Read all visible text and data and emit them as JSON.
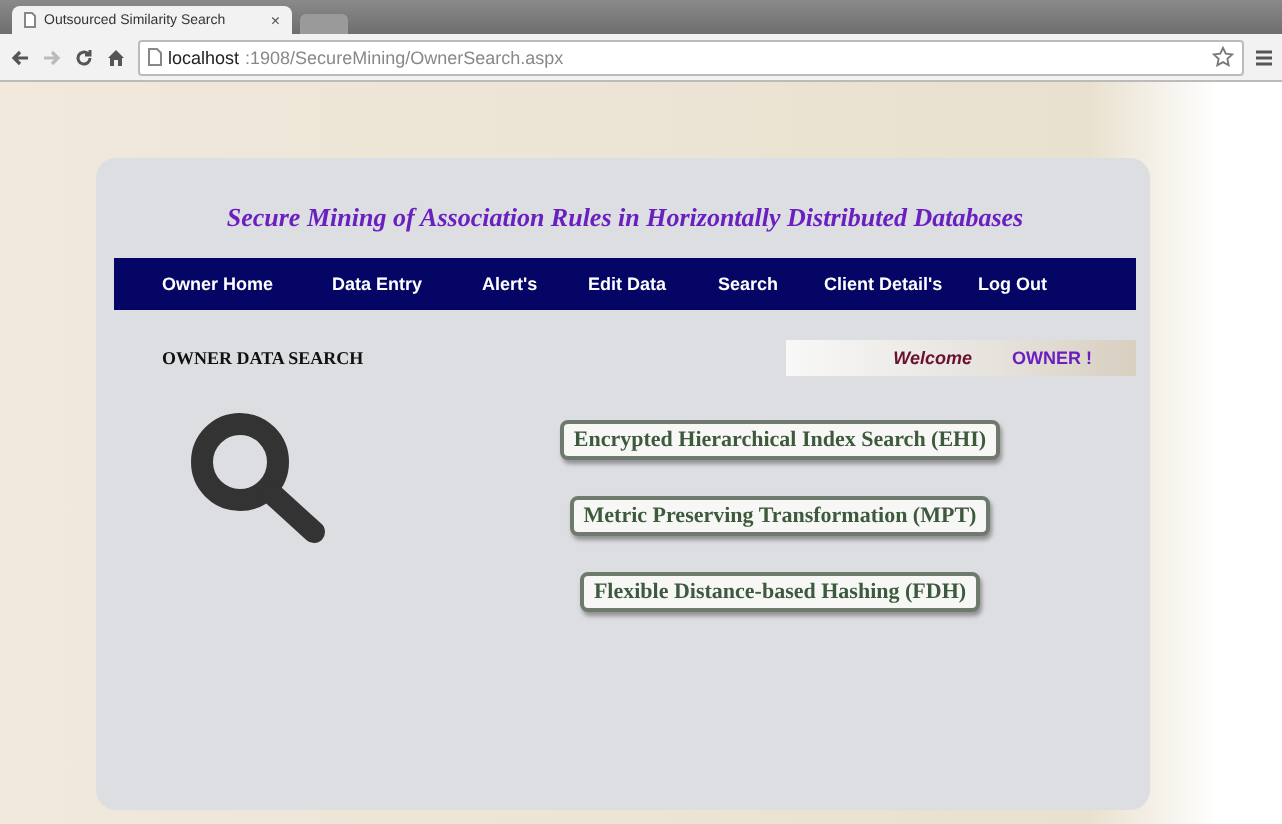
{
  "browser": {
    "tab_title": "Outsourced Similarity Search",
    "tab_close": "×",
    "url_host": "localhost",
    "url_path": ":1908/SecureMining/OwnerSearch.aspx"
  },
  "site_title": "Secure Mining of Association Rules in Horizontally Distributed Databases",
  "nav": [
    "Owner Home",
    "Data Entry",
    "Alert's",
    "Edit Data",
    "Search",
    "Client Detail's",
    "Log Out"
  ],
  "section_title": "OWNER DATA SEARCH",
  "welcome": {
    "label": "Welcome",
    "user": "OWNER !"
  },
  "search_buttons": [
    "Encrypted Hierarchical Index Search (EHI)",
    "Metric Preserving Transformation (MPT)",
    "Flexible Distance-based Hashing (FDH)"
  ]
}
